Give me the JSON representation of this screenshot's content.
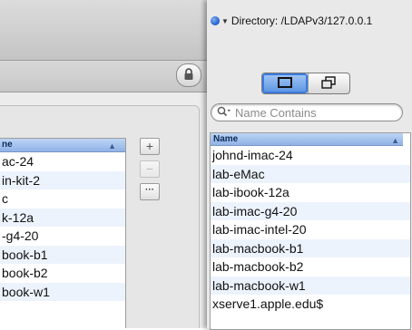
{
  "back_window": {
    "list": {
      "header": "ne",
      "rows": [
        "ac-24",
        "in-kit-2",
        "c",
        "k-12a",
        "-g4-20",
        "book-b1",
        "book-b2",
        "book-w1"
      ]
    },
    "buttons": {
      "add": "+",
      "remove": "−",
      "more": "···"
    },
    "icons": {
      "lock": "lock-icon",
      "sort": "sort-ascending-icon"
    }
  },
  "directory": {
    "label": "Directory: /LDAPv3/127.0.0.1",
    "icon": "globe-icon"
  },
  "view_toggle": {
    "options": [
      "single-window-icon",
      "dual-window-icon"
    ],
    "selected": "single-window-icon"
  },
  "search": {
    "placeholder": "Name Contains",
    "icon": "search-icon"
  },
  "computer_list": {
    "column_header": "Name",
    "sort_indicator": "▲",
    "rows": [
      "johnd-imac-24",
      "lab-eMac",
      "lab-ibook-12a",
      "lab-imac-g4-20",
      "lab-imac-intel-20",
      "lab-macbook-b1",
      "lab-macbook-b2",
      "lab-macbook-w1",
      "xserve1.apple.edu$"
    ]
  },
  "colors": {
    "selection_header": "#8fb2e6",
    "alt_row": "#edf3fd",
    "accent": "#3a7be0"
  }
}
